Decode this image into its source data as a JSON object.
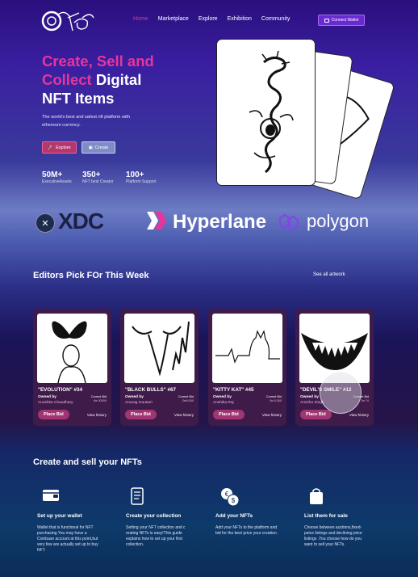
{
  "nav": {
    "links": [
      "Home",
      "Marketplace",
      "Explore",
      "Exhibition",
      "Community"
    ],
    "wallet_label": "Connect Wallet"
  },
  "hero": {
    "title_line1": "Create, Sell and",
    "title_line2_pink": "Collect",
    "title_line2_white": " Digital",
    "title_line3": "NFT Items",
    "subtitle": "The world's best and safest nft platform with ethereum currency.",
    "explore_label": "Explore",
    "create_label": "Create",
    "stats": [
      {
        "value": "50M+",
        "label": "ExecutiveAssets"
      },
      {
        "value": "350+",
        "label": "NFT best Creator"
      },
      {
        "value": "100+",
        "label": "Platform Support"
      }
    ]
  },
  "partners": {
    "xdc": "XDC",
    "hyperlane": "Hyperlane",
    "polygon": "polygon"
  },
  "editors": {
    "title": "Editors Pick FOr This Week",
    "see_all": "See all artwork",
    "items": [
      {
        "name": "\"EVOLUTION\" #34",
        "owned_label": "Owned by",
        "owner": "Anushka Chaudhary",
        "bid_label": "Current Bid",
        "bid": "8e.00000",
        "bid_button": "Place Bid",
        "history": "View history"
      },
      {
        "name": "\"BLACK BULLS\" #67",
        "owned_label": "Owned by",
        "owner": "Anurag Gautam",
        "bid_label": "Current Bid",
        "bid": "0e8.000",
        "bid_button": "Place Bid",
        "history": "View history"
      },
      {
        "name": "\"KITTY KAT\" #45",
        "owned_label": "Owned by",
        "owner": "Anshika Raj",
        "bid_label": "Current Bid",
        "bid": "0e.5.000",
        "bid_button": "Place Bid",
        "history": "View history"
      },
      {
        "name": "\"DEVIL'S SMILE\" #12",
        "owned_label": "Owned by",
        "owner": "Amisha Singh",
        "bid_label": "Current Bid",
        "bid": "0e.74",
        "bid_button": "Place Bid",
        "history": "View history"
      }
    ]
  },
  "steps": {
    "title": "Create and sell your NFTs",
    "items": [
      {
        "title": "Set up your wallet",
        "desc": "Wallet that is functional for NFT purchasing.You may have a Coinbase account at this point,but very few are actually set up to buy NFT.",
        "icon": "wallet-icon"
      },
      {
        "title": "Create your collection",
        "desc": "Setting your NFT collection and c reating NFTs is easy!This guide explains how to set up your first collection.",
        "icon": "document-icon"
      },
      {
        "title": "Add your NFTs",
        "desc": "Add your NFTs to the platform and bid for the best price your creation.",
        "icon": "coins-icon"
      },
      {
        "title": "List them for sale",
        "desc": "Choose between auctions,fixed-peice listings and declining price listings .You choose how do you want to sell your NFTs.",
        "icon": "shopping-bag-icon"
      }
    ]
  },
  "colors": {
    "accent_pink": "#e8359b",
    "wallet_purple": "#6a2ad2",
    "card_bg": "#3f1b4a"
  }
}
